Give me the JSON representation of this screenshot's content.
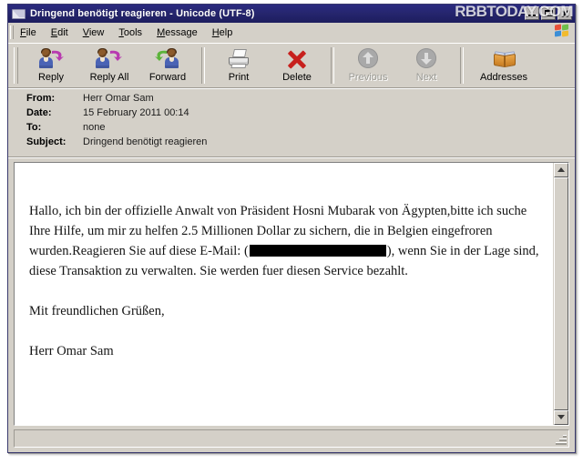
{
  "window": {
    "title": "Dringend benötigt reagieren - Unicode (UTF-8)",
    "icon": "envelope-icon",
    "watermark": "RBBTODAY.COM",
    "controls": {
      "minimize_label": "Minimize",
      "maximize_label": "Maximize",
      "close_label": "Close"
    }
  },
  "menubar": {
    "items": [
      {
        "label": "File",
        "accel": "F"
      },
      {
        "label": "Edit",
        "accel": "E"
      },
      {
        "label": "View",
        "accel": "V"
      },
      {
        "label": "Tools",
        "accel": "T"
      },
      {
        "label": "Message",
        "accel": "M"
      },
      {
        "label": "Help",
        "accel": "H"
      }
    ],
    "brand_icon": "windows-flag-icon"
  },
  "toolbar": {
    "buttons": [
      {
        "label": "Reply",
        "icon": "reply-icon",
        "enabled": true
      },
      {
        "label": "Reply All",
        "icon": "reply-all-icon",
        "enabled": true
      },
      {
        "label": "Forward",
        "icon": "forward-icon",
        "enabled": true
      },
      {
        "label": "Print",
        "icon": "printer-icon",
        "enabled": true
      },
      {
        "label": "Delete",
        "icon": "delete-x-icon",
        "enabled": true
      },
      {
        "label": "Previous",
        "icon": "arrow-up-icon",
        "enabled": false
      },
      {
        "label": "Next",
        "icon": "arrow-down-icon",
        "enabled": false
      },
      {
        "label": "Addresses",
        "icon": "address-book-icon",
        "enabled": true
      }
    ]
  },
  "headers": {
    "from_label": "From:",
    "from_value": "Herr Omar Sam",
    "date_label": "Date:",
    "date_value": "15 February 2011 00:14",
    "to_label": "To:",
    "to_value": "none",
    "subject_label": "Subject:",
    "subject_value": "Dringend benötigt reagieren"
  },
  "body": {
    "paragraph1_part1": "Hallo, ich bin der offizielle Anwalt von Präsident Hosni Mubarak von Ägypten,bitte ich suche Ihre Hilfe, um mir zu helfen 2.5 Millionen Dollar zu sichern, die in Belgien eingefroren wurden.Reagieren Sie auf diese E-Mail: (",
    "redacted_label": "redacted-email-address",
    "paragraph1_part2": "), wenn Sie in der Lage sind, diese Transaktion zu verwalten. Sie werden fuer diesen Service bezahlt.",
    "closing": "Mit freundlichen Grüßen,",
    "signature": "Herr Omar Sam"
  },
  "scrollbar": {
    "up_label": "Scroll up",
    "down_label": "Scroll down"
  },
  "statusbar": {
    "text": ""
  },
  "colors": {
    "titlebar": "#26266f",
    "window_face": "#d4d0c8",
    "delete_red": "#c7201d",
    "body_background": "#ffffff",
    "redaction_black": "#000000"
  }
}
